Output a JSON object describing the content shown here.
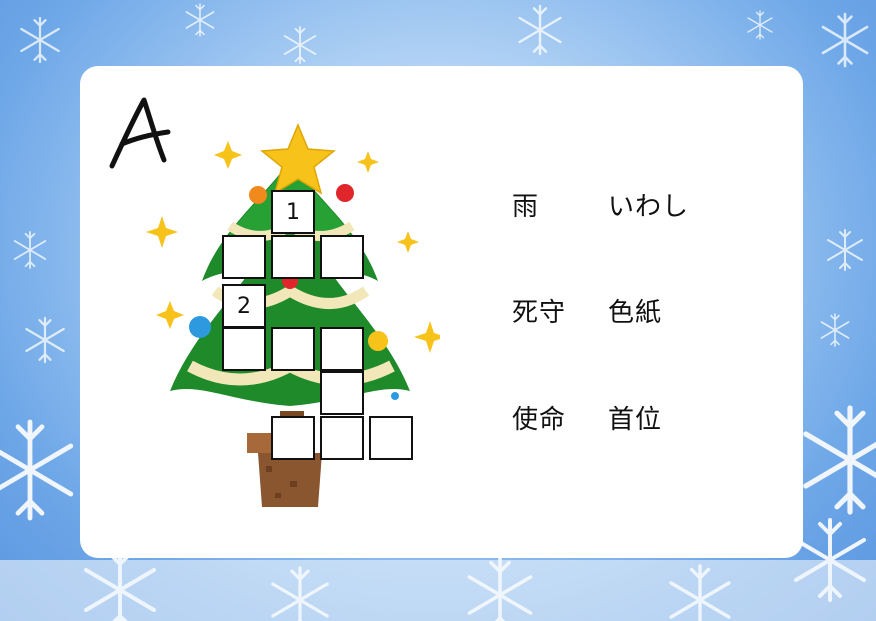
{
  "puzzle": {
    "label": "A",
    "numbers": [
      "1",
      "2"
    ],
    "clues": [
      {
        "left": "雨",
        "right": "いわし"
      },
      {
        "left": "死守",
        "right": "色紙"
      },
      {
        "left": "使命",
        "right": "首位"
      }
    ]
  },
  "colors": {
    "tree": "#1f8a2a",
    "garland": "#f2e7b8",
    "star": "#f7c21a",
    "pot": "#8a5630",
    "background": "#6fa8e8"
  }
}
